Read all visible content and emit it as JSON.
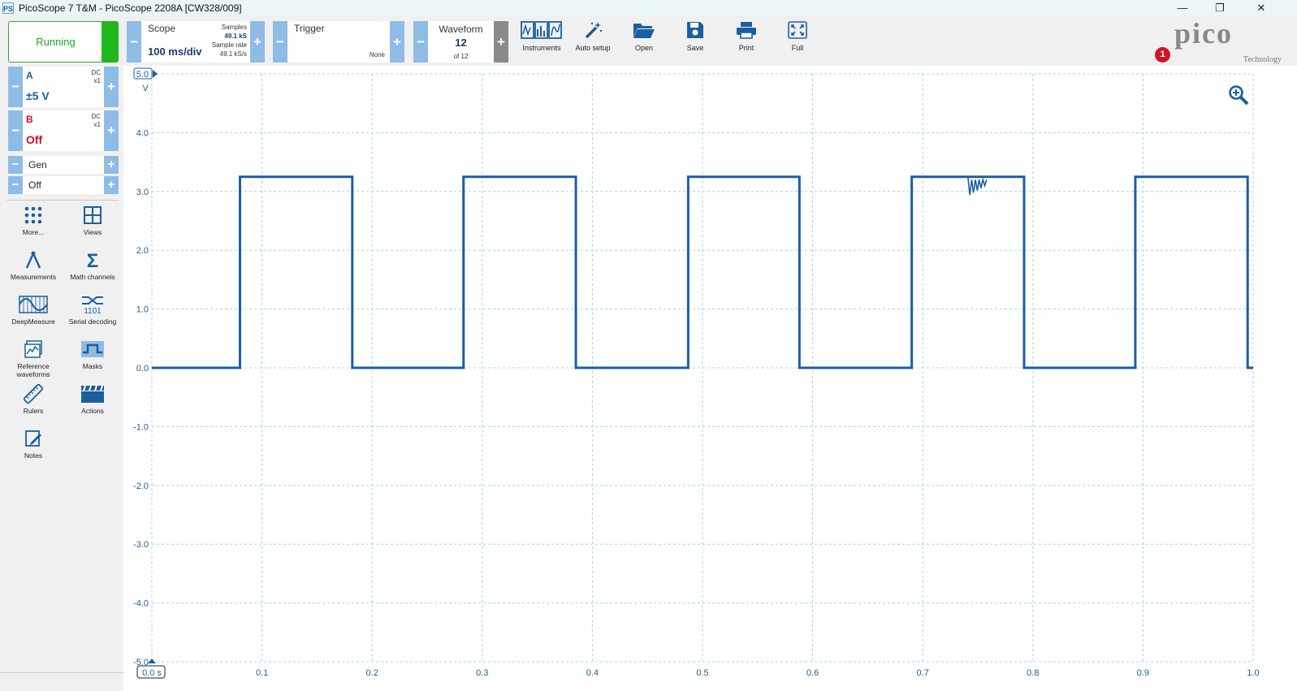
{
  "window": {
    "app_icon": "PS",
    "title": "PicoScope 7 T&M  - PicoScope 2208A [CW328/009]",
    "minimize": "—",
    "maximize": "❐",
    "close": "✕"
  },
  "status": {
    "label": "Running",
    "color": "#1fb81f"
  },
  "channels": [
    {
      "name": "A",
      "coupling": "DC",
      "probe": "x1",
      "range": "±5 V",
      "color": "#1a5fa0"
    },
    {
      "name": "B",
      "coupling": "DC",
      "probe": "x1",
      "range": "Off",
      "color": "#c8102e"
    }
  ],
  "generator": {
    "label": "Gen",
    "state": "Off"
  },
  "tools": [
    {
      "label": "More...",
      "icon": "dots-grid-icon"
    },
    {
      "label": "Views",
      "icon": "views-grid-icon"
    },
    {
      "label": "Measurements",
      "icon": "measurements-icon"
    },
    {
      "label": "Math channels",
      "icon": "sigma-icon"
    },
    {
      "label": "DeepMeasure",
      "icon": "deepmeasure-icon"
    },
    {
      "label": "Serial decoding",
      "icon": "serial-decoding-icon"
    },
    {
      "label": "Reference waveforms",
      "icon": "reference-waveforms-icon"
    },
    {
      "label": "Masks",
      "icon": "masks-icon"
    },
    {
      "label": "Rulers",
      "icon": "ruler-icon"
    },
    {
      "label": "Actions",
      "icon": "clapper-icon"
    },
    {
      "label": "Notes",
      "icon": "notes-icon"
    }
  ],
  "toolbar": {
    "scope": {
      "label": "Scope",
      "timebase": "100 ms/div",
      "samples_label": "Samples",
      "samples_value": "49.1 kS",
      "rate_label": "Sample rate",
      "rate_value": "49.1 kS/s"
    },
    "trigger": {
      "label": "Trigger",
      "mode": "None"
    },
    "waveform": {
      "label": "Waveform",
      "current": "12",
      "total": "of 12"
    },
    "buttons": [
      {
        "label": "Instruments",
        "icon": "instruments-icon"
      },
      {
        "label": "Auto setup",
        "icon": "auto-setup-wand-icon"
      },
      {
        "label": "Open",
        "icon": "folder-open-icon"
      },
      {
        "label": "Save",
        "icon": "save-disk-icon"
      },
      {
        "label": "Print",
        "icon": "printer-icon"
      },
      {
        "label": "Full",
        "icon": "fullscreen-icon"
      }
    ],
    "logo": {
      "word": "pico",
      "subtitle": "Technology",
      "notification_count": "1"
    }
  },
  "chart_data": {
    "type": "line",
    "title": "",
    "xlabel": "",
    "ylabel": "V",
    "x_unit_label": "s",
    "xlim": [
      0,
      1
    ],
    "ylim": [
      -5,
      5
    ],
    "grid": true,
    "x_ticks": [
      "0.0",
      "0.1",
      "0.2",
      "0.3",
      "0.4",
      "0.5",
      "0.6",
      "0.7",
      "0.8",
      "0.9",
      "1.0"
    ],
    "y_ticks": [
      "5.0",
      "4.0",
      "3.0",
      "2.0",
      "1.0",
      "0.0",
      "-1.0",
      "-2.0",
      "-3.0",
      "-4.0",
      "-5.0"
    ],
    "series": [
      {
        "name": "A",
        "color": "#1a5fa0",
        "high": 3.25,
        "low": 0.0,
        "segments": [
          [
            0.0,
            0.08,
            0.0
          ],
          [
            0.08,
            0.182,
            3.25
          ],
          [
            0.182,
            0.283,
            0.0
          ],
          [
            0.283,
            0.385,
            3.25
          ],
          [
            0.385,
            0.487,
            0.0
          ],
          [
            0.487,
            0.588,
            3.25
          ],
          [
            0.588,
            0.69,
            0.0
          ],
          [
            0.69,
            0.792,
            3.25
          ],
          [
            0.792,
            0.893,
            0.0
          ],
          [
            0.893,
            0.995,
            3.25
          ],
          [
            0.995,
            1.0,
            0.0
          ]
        ],
        "glitch": {
          "x_start": 0.741,
          "x_end": 0.758,
          "min": 2.92
        }
      }
    ]
  }
}
